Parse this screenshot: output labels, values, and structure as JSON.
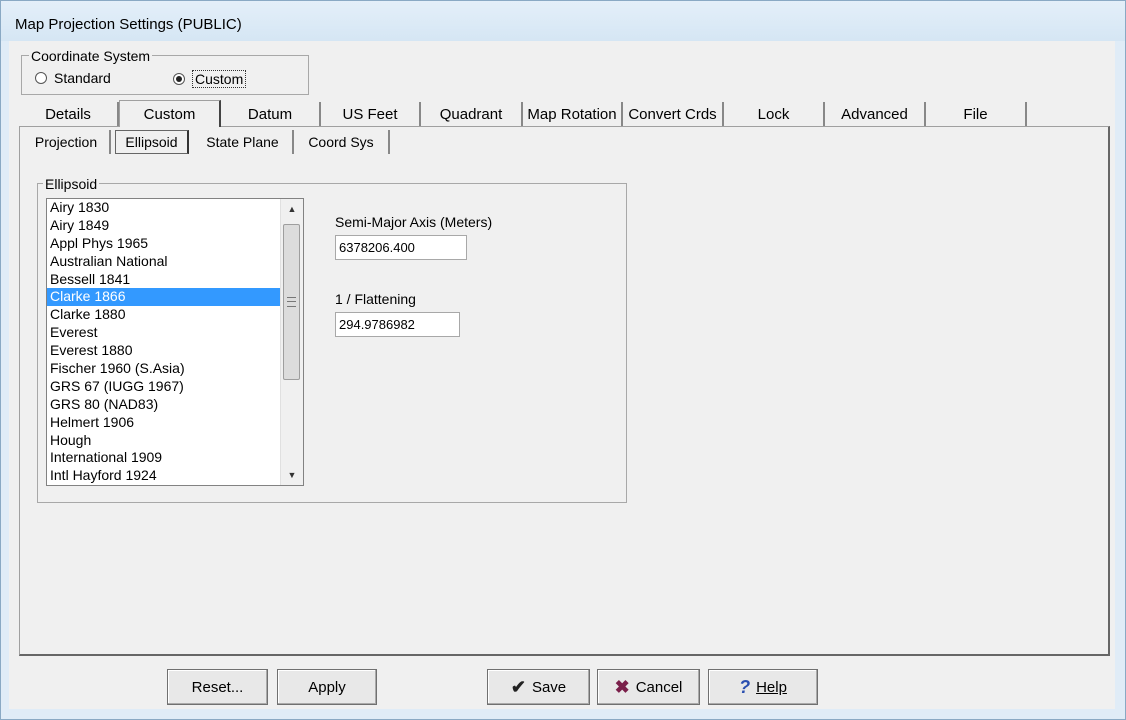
{
  "window": {
    "title": "Map Projection Settings (PUBLIC)"
  },
  "coordinate_system": {
    "label": "Coordinate System",
    "options": [
      {
        "label": "Standard",
        "checked": false
      },
      {
        "label": "Custom",
        "checked": true
      }
    ]
  },
  "tabs": [
    "Details",
    "Custom",
    "Datum",
    "US Feet",
    "Quadrant",
    "Map Rotation",
    "Convert Crds",
    "Lock",
    "Advanced",
    "File"
  ],
  "active_tab": "Custom",
  "subtabs": [
    "Projection",
    "Ellipsoid",
    "State Plane",
    "Coord Sys"
  ],
  "active_subtab": "Ellipsoid",
  "ellipsoid": {
    "group_label": "Ellipsoid",
    "items": [
      "Airy 1830",
      "Airy 1849",
      "Appl Phys 1965",
      "Australian National",
      "Bessell 1841",
      "Clarke 1866",
      "Clarke 1880",
      "Everest",
      "Everest 1880",
      "Fischer 1960 (S.Asia)",
      "GRS 67 (IUGG 1967)",
      "GRS 80 (NAD83)",
      "Helmert 1906",
      "Hough",
      "International 1909",
      "Intl Hayford 1924"
    ],
    "selected": "Clarke 1866",
    "semi_major_label": "Semi-Major Axis (Meters)",
    "semi_major_value": "6378206.400",
    "flattening_label": "1 / Flattening",
    "flattening_value": "294.9786982"
  },
  "buttons": {
    "reset": "Reset...",
    "apply": "Apply",
    "save": "Save",
    "cancel": "Cancel",
    "help": "Help"
  },
  "colors": {
    "selection": "#3399ff",
    "save_icon": "#222222",
    "cancel_icon": "#7a1f4a",
    "help_icon": "#2a4fb0"
  }
}
